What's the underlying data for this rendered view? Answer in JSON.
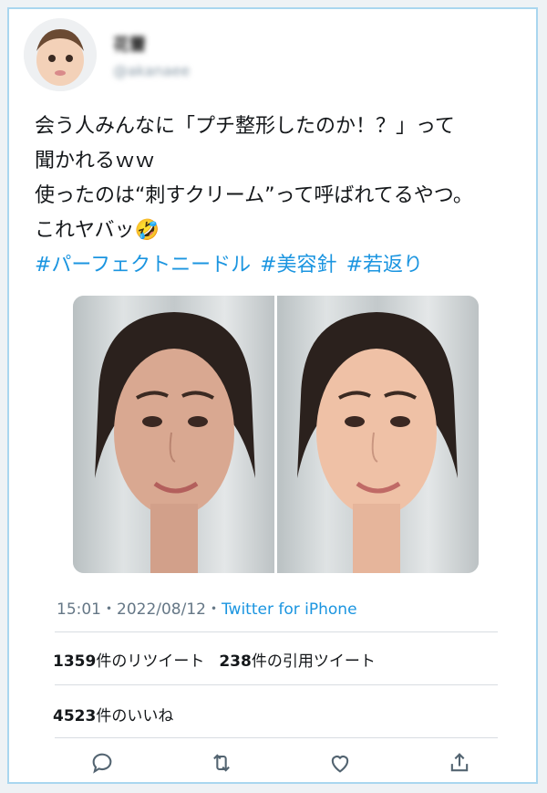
{
  "user": {
    "name": "花蕾",
    "handle": "@akanaee"
  },
  "tweet": {
    "lines": [
      "会う人みんなに「プチ整形したのか！？」って",
      "聞かれるｗｗ",
      "使ったのは“刺すクリーム”って呼ばれてるやつ。",
      "これヤバッ🤣"
    ],
    "hashtags": [
      "#パーフェクトニードル",
      "#美容針",
      "#若返り"
    ]
  },
  "meta": {
    "time": "15:01",
    "date": "2022/08/12",
    "source": "Twitter for iPhone"
  },
  "stats": {
    "retweets": "1359",
    "retweets_label": "件のリツイート",
    "quotes": "238",
    "quotes_label": "件の引用ツイート",
    "likes": "4523",
    "likes_label": "件のいいね"
  },
  "actions": [
    "reply-icon",
    "retweet-icon",
    "like-icon",
    "share-icon"
  ]
}
